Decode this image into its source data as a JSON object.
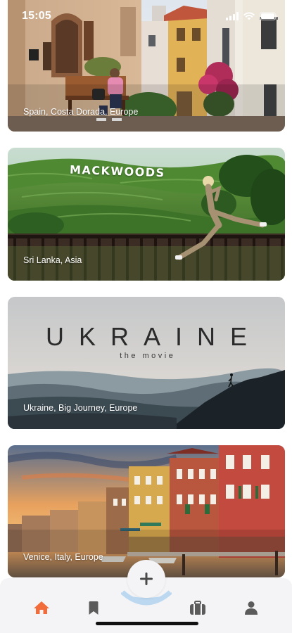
{
  "status_bar": {
    "time": "15:05"
  },
  "cards": [
    {
      "caption": "Spain, Costa Dorada, Europe"
    },
    {
      "caption": "Sri Lanka, Asia",
      "sign": "MACKWOODS"
    },
    {
      "caption": "Ukraine, Big Journey, Europe",
      "title": "UKRAINE",
      "subtitle": "the movie"
    },
    {
      "caption": "Venice, Italy, Europe"
    }
  ],
  "tabbar": {
    "tabs": [
      {
        "icon": "home-icon",
        "active": true
      },
      {
        "icon": "bookmark-icon",
        "active": false
      },
      {
        "icon": "add-icon",
        "active": false
      },
      {
        "icon": "suitcase-icon",
        "active": false
      },
      {
        "icon": "profile-icon",
        "active": false
      }
    ],
    "active_color": "#f26b3a",
    "inactive_color": "#5b5b5b",
    "highlight_color": "#bcd8f0"
  }
}
